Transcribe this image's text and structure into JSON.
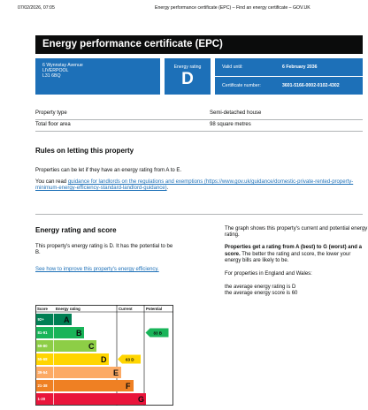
{
  "print_header": {
    "datetime": "07/02/2026, 07:05",
    "page_title": "Energy performance certificate (EPC) – Find an energy certificate – GOV.UK"
  },
  "certificate": {
    "heading": "Energy performance certificate (EPC)",
    "address_lines": [
      "6 Wynnstay Avenue",
      "LIVERPOOL",
      "L31 6BQ"
    ],
    "rating_label": "Energy rating",
    "rating": "D",
    "valid_until_label": "Valid until:",
    "valid_until": "6 February 2036",
    "cert_number_label": "Certificate number:",
    "cert_number": "3601-5166-0002-0102-4302"
  },
  "summary": {
    "property_type_label": "Property type",
    "property_type": "Semi-detached house",
    "floor_area_label": "Total floor area",
    "floor_area": "98 square metres"
  },
  "letting": {
    "heading": "Rules on letting this property",
    "p1": "Properties can be let if they have an energy rating from A to E.",
    "p2_prefix": "You can read ",
    "p2_link": "guidance for landlords on the regulations and exemptions (https://www.gov.uk/guidance/domestic-private-rented-property-minimum-energy-efficiency-standard-landlord-guidance)",
    "p2_suffix": "."
  },
  "rating_section": {
    "heading": "Energy rating and score",
    "p1": "This property's energy rating is D. It has the potential to be B.",
    "link": "See how to improve this property's energy efficiency.",
    "right_p1": "The graph shows this property's current and potential energy rating.",
    "right_p2_bold": "Properties get a rating from A (best) to G (worst) and a score.",
    "right_p2_rest": " The better the rating and score, the lower your energy bills are likely to be.",
    "right_p3": "For properties in England and Wales:",
    "right_p4": "the average energy rating is D",
    "right_p5": "the average energy score is 60"
  },
  "chart_data": {
    "type": "table",
    "headers": [
      "Score",
      "Energy rating",
      "Current",
      "Potential"
    ],
    "bands": [
      {
        "range": "92+",
        "letter": "A",
        "color": "#008054"
      },
      {
        "range": "81-91",
        "letter": "B",
        "color": "#19b459"
      },
      {
        "range": "69-80",
        "letter": "C",
        "color": "#8dce46"
      },
      {
        "range": "55-68",
        "letter": "D",
        "color": "#ffd500"
      },
      {
        "range": "39-54",
        "letter": "E",
        "color": "#fcaa65"
      },
      {
        "range": "21-38",
        "letter": "F",
        "color": "#ef8023"
      },
      {
        "range": "1-20",
        "letter": "G",
        "color": "#e9153b"
      }
    ],
    "current": {
      "score": 63,
      "letter": "D",
      "label": "63 D",
      "color": "#ffd500"
    },
    "potential": {
      "score": 83,
      "letter": "B",
      "label": "83 B",
      "color": "#19b459"
    }
  }
}
